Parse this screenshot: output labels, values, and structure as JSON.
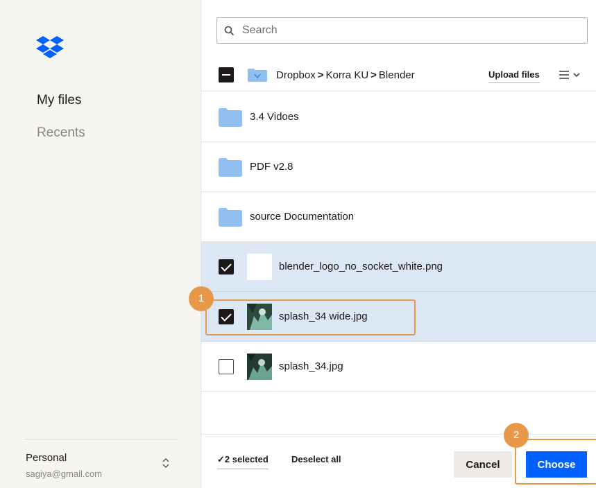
{
  "sidebar": {
    "logo_icon": "dropbox-logo",
    "nav": [
      {
        "label": "My files",
        "active": true
      },
      {
        "label": "Recents",
        "active": false
      }
    ],
    "account": {
      "name": "Personal",
      "email": "sagiya@gmail.com",
      "switch_icon": "chevron-up-down-icon"
    }
  },
  "search": {
    "placeholder": "Search",
    "value": "",
    "icon": "search-icon"
  },
  "toolbar": {
    "breadcrumb": [
      "Dropbox",
      "Korra KU",
      "Blender"
    ],
    "separator": ">",
    "upload_label": "Upload files",
    "view_icon": "list-view-icon",
    "master_checkbox_state": "indeterminate"
  },
  "files": [
    {
      "name": "3.4 Vidoes",
      "type": "folder",
      "checked": false,
      "selected": false
    },
    {
      "name": "PDF v2.8",
      "type": "folder",
      "checked": false,
      "selected": false
    },
    {
      "name": "source Documentation",
      "type": "folder",
      "checked": false,
      "selected": false
    },
    {
      "name": "blender_logo_no_socket_white.png",
      "type": "image",
      "checked": true,
      "selected": true,
      "thumb": "white"
    },
    {
      "name": "splash_34 wide.jpg",
      "type": "image",
      "checked": true,
      "selected": true,
      "thumb": "splash"
    },
    {
      "name": "splash_34.jpg",
      "type": "image",
      "checked": false,
      "selected": false,
      "thumb": "splash"
    }
  ],
  "footer": {
    "selected_label": "✓2 selected",
    "deselect_label": "Deselect all",
    "cancel_label": "Cancel",
    "choose_label": "Choose"
  },
  "annotations": {
    "step1": "1",
    "step2": "2"
  },
  "colors": {
    "accent": "#0061fe",
    "selected_row": "#dde8f7",
    "annotation": "#e89849",
    "folder": "#90bff0",
    "sidebar_bg": "#f7f5f2"
  }
}
